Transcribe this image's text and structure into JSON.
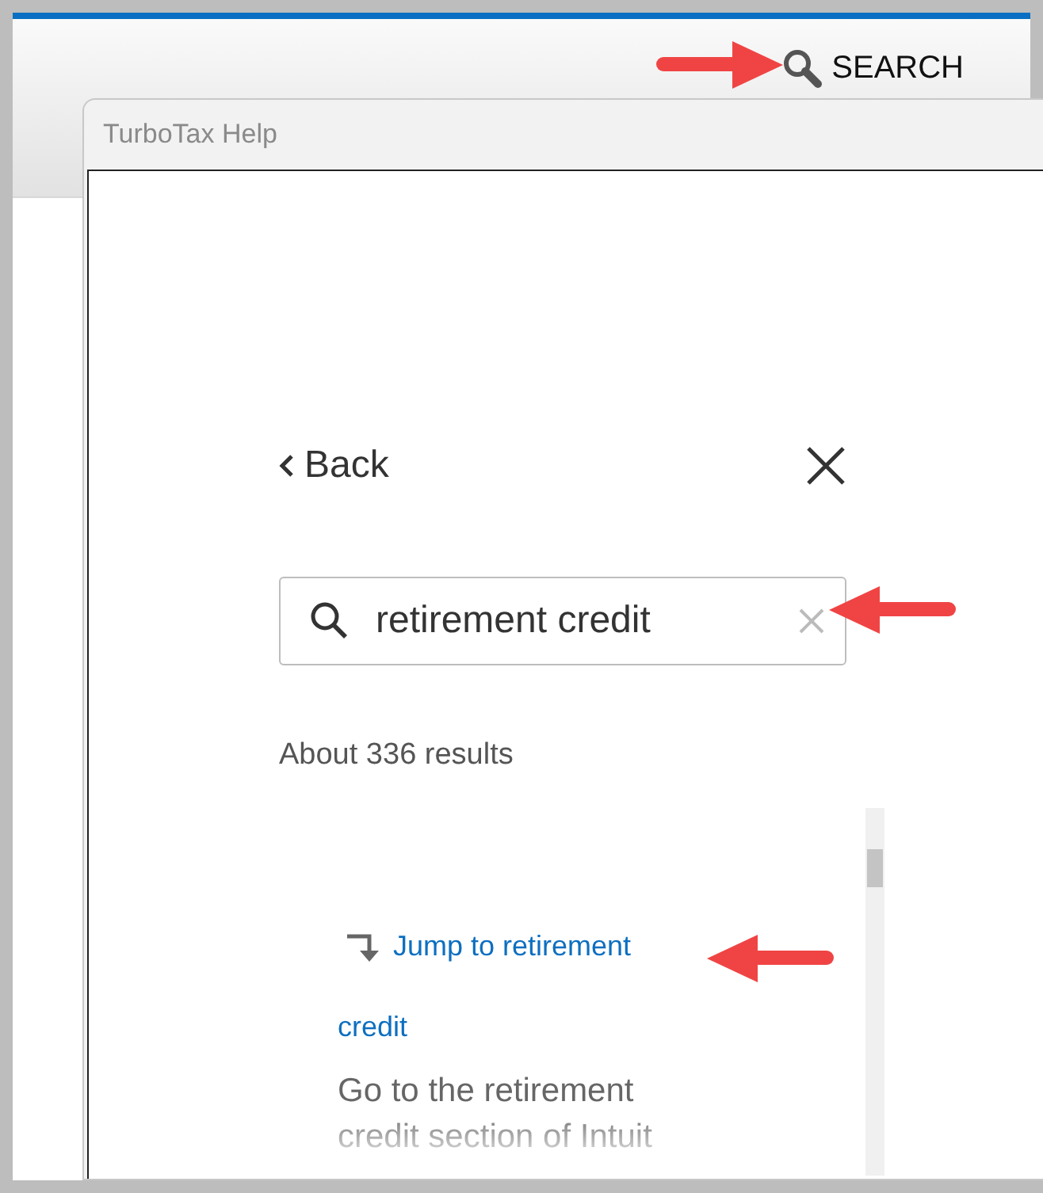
{
  "header": {
    "search_label": "SEARCH"
  },
  "help_window": {
    "title": "TurboTax Help",
    "back_label": "Back",
    "search": {
      "value": "retirement credit"
    },
    "results_count": "About 336 results",
    "results": [
      {
        "link": "Jump to retirement credit",
        "description": "Go to the retirement credit section of Intuit"
      }
    ]
  }
}
